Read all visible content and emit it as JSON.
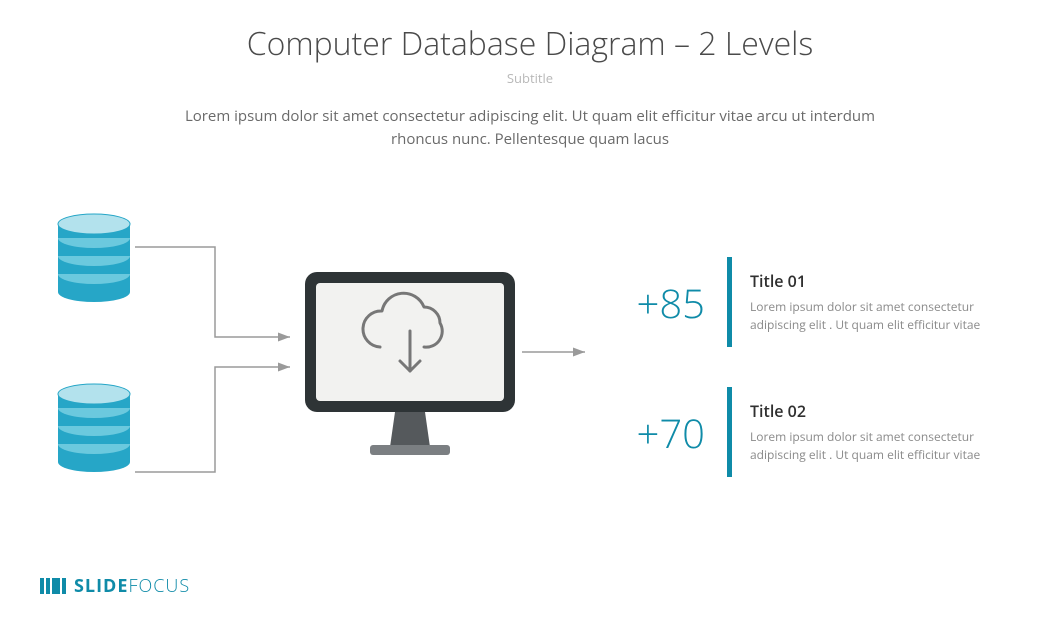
{
  "title": "Computer Database Diagram – 2 Levels",
  "subtitle": "Subtitle",
  "description": "Lorem ipsum dolor sit amet consectetur adipiscing elit. Ut quam elit efficitur vitae arcu ut interdum rhoncus nunc. Pellentesque quam lacus",
  "stats": [
    {
      "value": "+85",
      "title": "Title 01",
      "body": "Lorem ipsum dolor sit amet consectetur adipiscing elit . Ut quam elit efficitur vitae"
    },
    {
      "value": "+70",
      "title": "Title 02",
      "body": "Lorem ipsum dolor sit amet consectetur adipiscing elit . Ut quam elit efficitur vitae"
    }
  ],
  "brand": {
    "part1": "SLIDE",
    "part2": "FOCUS"
  },
  "colors": {
    "accent": "#0f8ba8",
    "dbLight": "#b3e2ed",
    "dbDark": "#26a6c7"
  }
}
